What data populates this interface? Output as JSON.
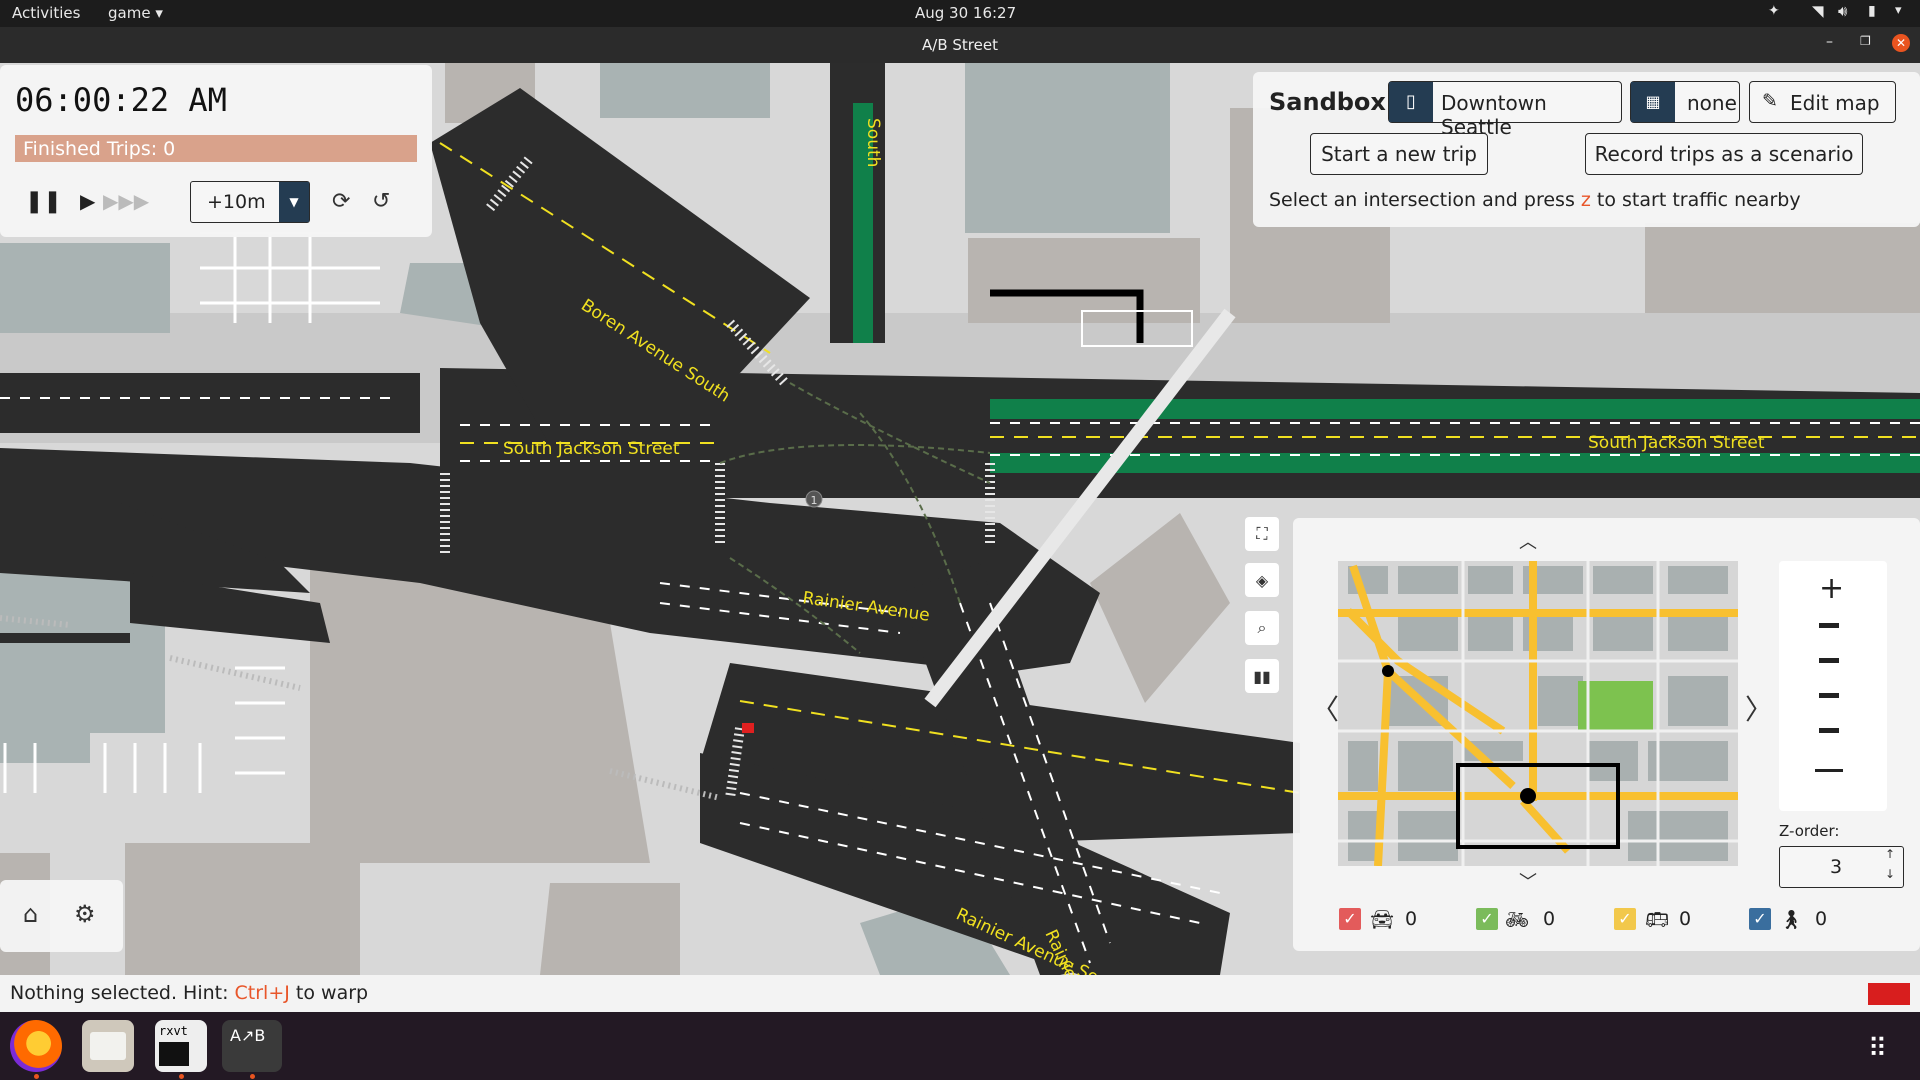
{
  "system_bar": {
    "activities": "Activities",
    "app_menu": "game",
    "clock": "Aug 30  16:27"
  },
  "window": {
    "title": "A/B Street"
  },
  "map": {
    "street_labels": [
      "Boren Avenue South",
      "South Jackson Street",
      "South Jackson Street",
      "Rainier Avenue",
      "Rainier Avenue South",
      "Rainier Avenue South",
      "South"
    ],
    "intersection_badge": "1"
  },
  "time_panel": {
    "clock": "06:00:22 AM",
    "finished_trips": "Finished Trips: 0",
    "jump_value": "+10m"
  },
  "sandbox_panel": {
    "title": "Sandbox",
    "map_name": "Downtown Seattle",
    "scenario": "none",
    "edit_map": "Edit map",
    "start_trip": "Start a new trip",
    "record_trips": "Record trips as a scenario",
    "hint_before": "Select an intersection and press ",
    "hint_key": "z",
    "hint_after": " to start traffic nearby"
  },
  "minimap": {
    "zorder_label": "Z-order:",
    "zorder_value": "3",
    "counts": {
      "car": "0",
      "bike": "0",
      "bus": "0",
      "pedestrian": "0"
    },
    "colors": {
      "car": "#e35b5b",
      "bike": "#7bbb5b",
      "bus": "#f2c84b",
      "pedestrian": "#3a6e9e"
    }
  },
  "status_bar": {
    "hint_before": "Nothing selected. Hint: ",
    "hint_key": "Ctrl+J",
    "hint_after": " to warp"
  },
  "dock": {
    "apps": [
      "firefox-icon",
      "files-icon",
      "rxvt-icon",
      "abstreet-icon"
    ],
    "rxvt_label": "rxvt"
  },
  "colors": {
    "accent_key": "#e8562a",
    "road": "#2c2c2c",
    "bike_lane": "#10804a",
    "center_line": "#f0e020",
    "finished_bar": "#d9a28b"
  }
}
